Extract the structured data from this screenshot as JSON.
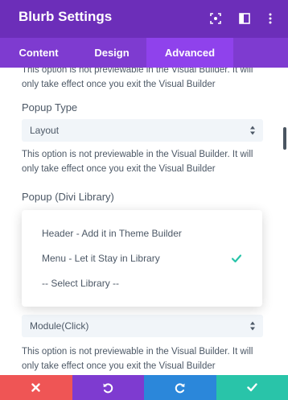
{
  "header": {
    "title": "Blurb Settings",
    "icons": [
      "focus-icon",
      "split-view-icon",
      "more-vertical-icon"
    ]
  },
  "tabs": [
    {
      "label": "Content",
      "active": false
    },
    {
      "label": "Design",
      "active": false
    },
    {
      "label": "Advanced",
      "active": true
    }
  ],
  "fields": {
    "top_description": "This option is not previewable in the Visual Builder. It will only take effect once you exit the Visual Builder",
    "popup_type": {
      "label": "Popup Type",
      "value": "Layout",
      "description": "This option is not previewable in the Visual Builder. It will only take effect once you exit the Visual Builder"
    },
    "popup_library": {
      "label": "Popup (Divi Library)",
      "options": [
        {
          "label": "Header - Add it in Theme Builder",
          "selected": false
        },
        {
          "label": "Menu - Let it Stay in Library",
          "selected": true
        },
        {
          "label": "-- Select Library --",
          "selected": false
        }
      ]
    },
    "trigger": {
      "value": "Module(Click)",
      "description": "This option is not previewable in the Visual Builder. It will only take effect once you exit the Visual Builder"
    }
  },
  "footer": {
    "buttons": [
      "close-icon",
      "undo-icon",
      "redo-icon",
      "save-check-icon"
    ]
  },
  "colors": {
    "header": "#6c2eb9",
    "tabs": "#7e3bd0",
    "active_tab": "#8f42ec",
    "cancel": "#ef5555",
    "undo": "#7e3bd0",
    "redo": "#2b87da",
    "save": "#29c4a9",
    "check": "#29c4a9"
  }
}
